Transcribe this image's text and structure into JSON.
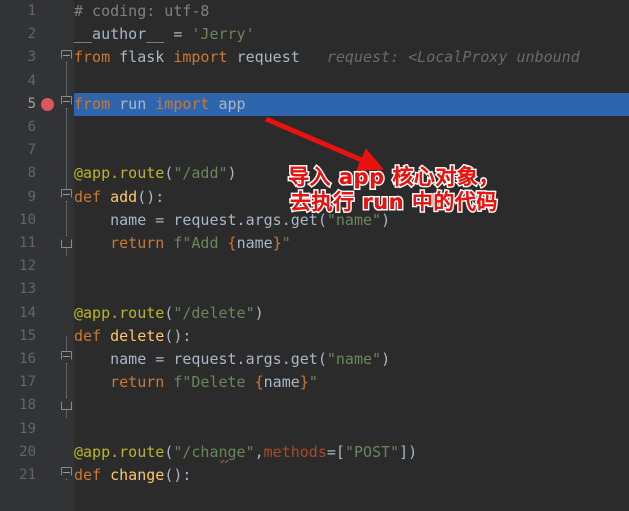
{
  "editor": {
    "background_color": "#2b2b2b",
    "gutter_color": "#313335",
    "selection_color": "#2f65ad",
    "breakpoint_color": "#db5860",
    "line_numbers": [
      "1",
      "2",
      "3",
      "4",
      "5",
      "6",
      "7",
      "8",
      "9",
      "10",
      "11",
      "12",
      "13",
      "14",
      "15",
      "16",
      "17",
      "18",
      "19",
      "20",
      "21"
    ],
    "current_line": "5",
    "breakpoint_line": "5",
    "inlay_hint": "request: <LocalProxy unbound",
    "lines": [
      {
        "n": "1",
        "text": "# coding: utf-8"
      },
      {
        "n": "2",
        "text": "__author__ = 'Jerry'"
      },
      {
        "n": "3",
        "text": "from flask import request"
      },
      {
        "n": "4",
        "text": ""
      },
      {
        "n": "5",
        "text": "from run import app"
      },
      {
        "n": "6",
        "text": ""
      },
      {
        "n": "7",
        "text": ""
      },
      {
        "n": "8",
        "text": "@app.route(\"/add\")"
      },
      {
        "n": "9",
        "text": "def add():"
      },
      {
        "n": "10",
        "text": "    name = request.args.get(\"name\")"
      },
      {
        "n": "11",
        "text": "    return f\"Add {name}\""
      },
      {
        "n": "12",
        "text": ""
      },
      {
        "n": "13",
        "text": ""
      },
      {
        "n": "14",
        "text": "@app.route(\"/delete\")"
      },
      {
        "n": "15",
        "text": "def delete():"
      },
      {
        "n": "16",
        "text": "    name = request.args.get(\"name\")"
      },
      {
        "n": "17",
        "text": "    return f\"Delete {name}\""
      },
      {
        "n": "18",
        "text": ""
      },
      {
        "n": "19",
        "text": ""
      },
      {
        "n": "20",
        "text": "@app.route(\"/change\",methods=[\"POST\"])"
      },
      {
        "n": "21",
        "text": "def change():"
      }
    ],
    "tokens": {
      "comment_coding": "# coding: utf-8",
      "author_name": "__author__ ",
      "author_eq": "= ",
      "author_value": "'Jerry'",
      "kw_from": "from",
      "kw_import": "import",
      "mod_flask": "flask",
      "name_request": "request",
      "mod_run": "run",
      "name_app": "app",
      "decorator_add": "@app.route",
      "route_add": "\"/add\"",
      "decorator_delete": "@app.route",
      "route_delete": "\"/delete\"",
      "decorator_change": "@app.route",
      "route_change": "\"/change\"",
      "kwarg_methods": "methods",
      "methods_value": "\"POST\"",
      "kw_def": "def",
      "fn_add": "add",
      "fn_delete": "delete",
      "fn_change": "change",
      "var_name": "name",
      "expr_request_args_get": "request.args.get",
      "arg_name": "\"name\"",
      "kw_return": "return",
      "fstr_add_prefix": "f\"Add ",
      "fstr_delete_prefix": "f\"Delete ",
      "fstr_brace_open": "{",
      "fstr_var": "name",
      "fstr_brace_close": "}",
      "fstr_quote": "\""
    }
  },
  "annotation": {
    "color": "#e8120f",
    "outline_color": "#ffffff",
    "line1": "导入 app 核心对象，",
    "line2": "去执行 run 中的代码",
    "arrow_color": "#e8120f"
  }
}
